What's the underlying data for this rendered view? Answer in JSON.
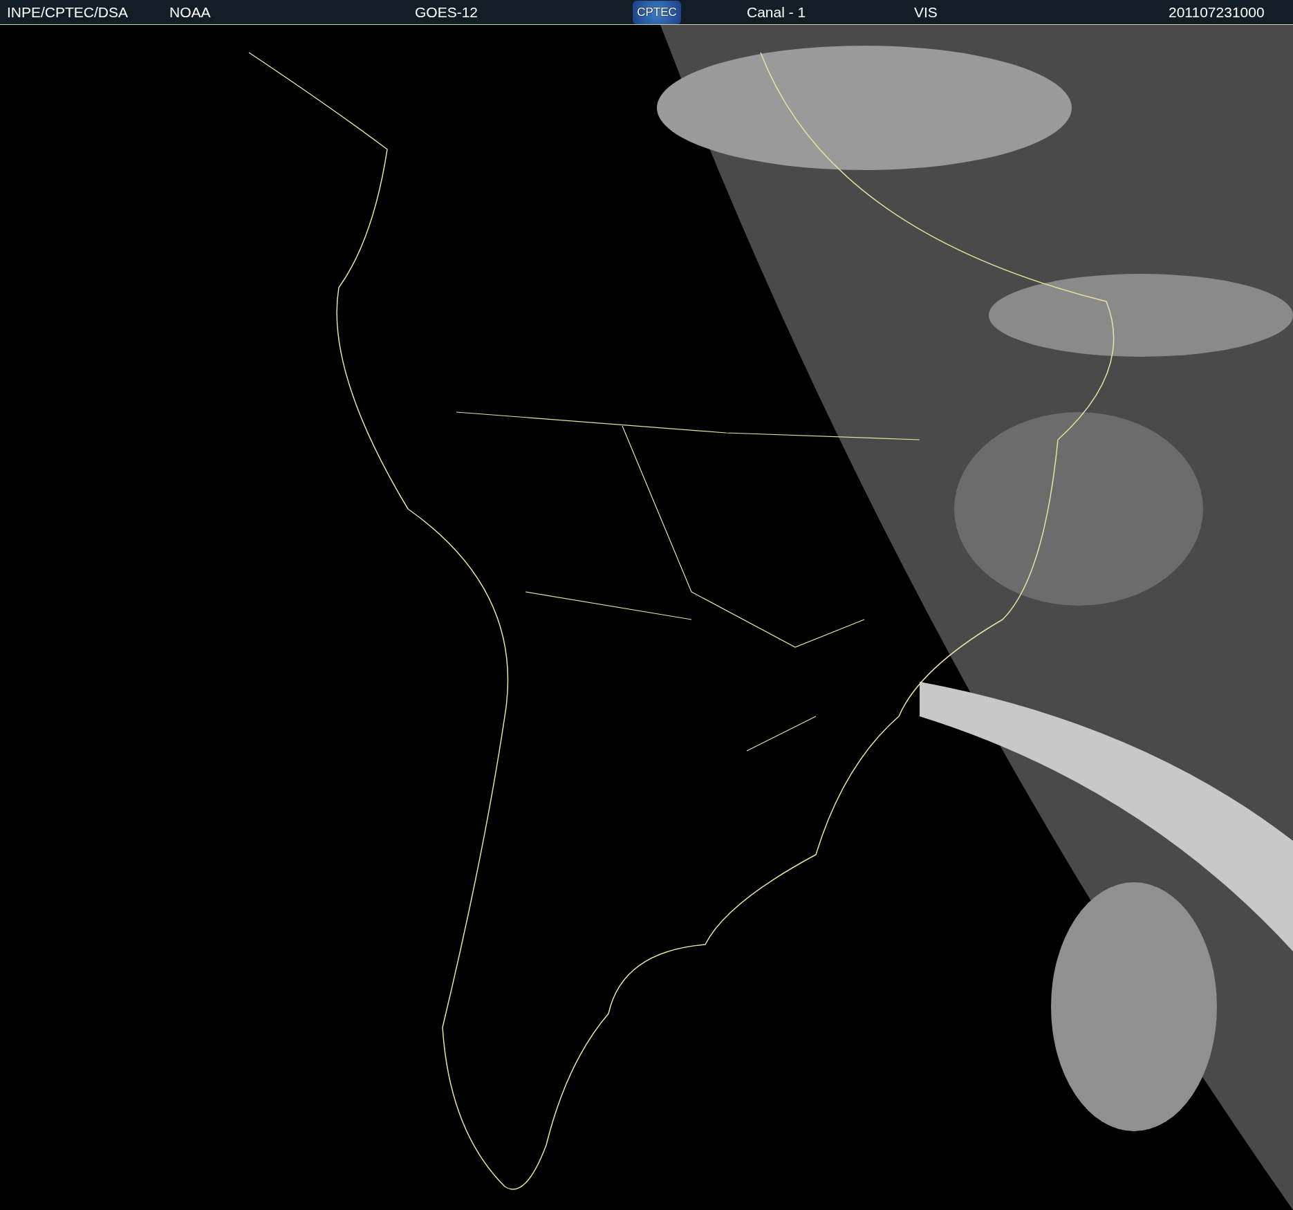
{
  "header": {
    "items": [
      {
        "kind": "text",
        "text": "INPE/CPTEC/DSA"
      },
      {
        "kind": "text",
        "text": "NOAA"
      },
      {
        "kind": "text",
        "text": "GOES-12"
      },
      {
        "kind": "logo",
        "text": "CPTEC"
      },
      {
        "kind": "text",
        "text": "Canal - 1"
      },
      {
        "kind": "text",
        "text": "VIS"
      },
      {
        "kind": "text",
        "text": "201107231000"
      }
    ]
  }
}
